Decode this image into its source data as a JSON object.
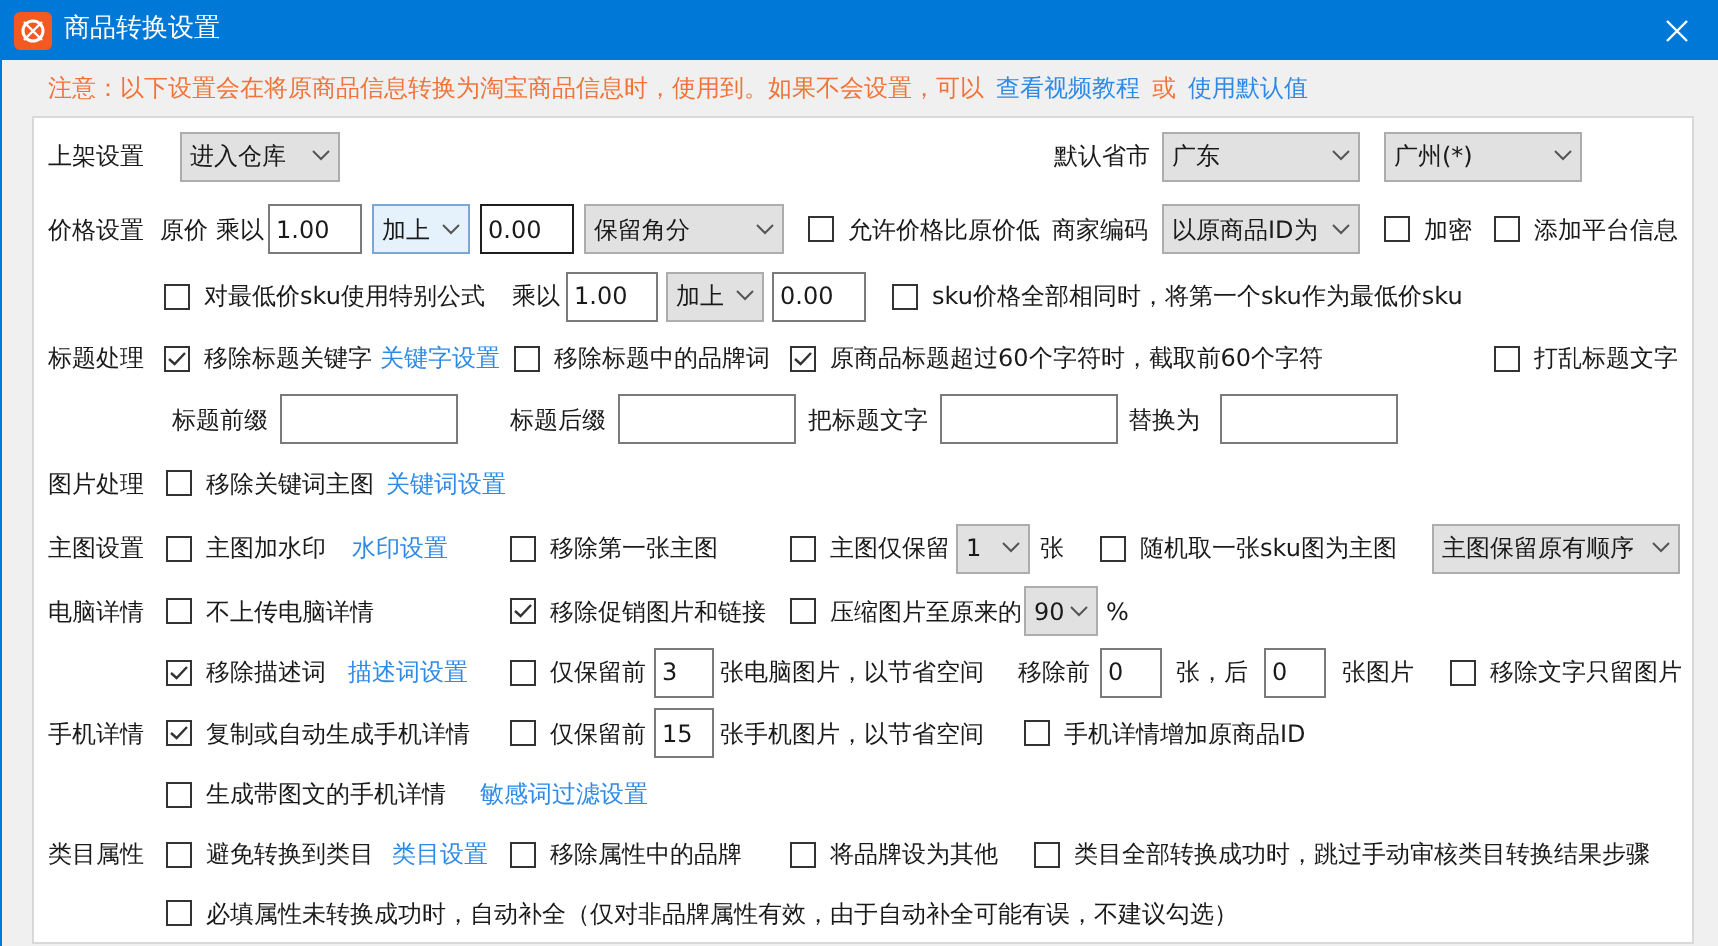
{
  "window": {
    "title": "商品转换设置"
  },
  "notice": [
    {
      "kind": "text",
      "text": "注意：以下设置会在将原商品信息转换为淘宝商品信息时，使用到。如果不会设置，可以"
    },
    {
      "kind": "link",
      "text": "查看视频教程"
    },
    {
      "kind": "text",
      "text": "或"
    },
    {
      "kind": "link",
      "text": "使用默认值"
    }
  ],
  "rows": [
    {
      "label": "上架设置",
      "items": [
        {
          "kind": "select",
          "value": "进入仓库"
        },
        {
          "kind": "text",
          "text": "默认省市"
        },
        {
          "kind": "select",
          "value": "广东"
        },
        {
          "kind": "select",
          "value": "广州(*)"
        }
      ]
    },
    {
      "label": "价格设置",
      "items": [
        {
          "kind": "text",
          "text": "原价"
        },
        {
          "kind": "text",
          "text": "乘以"
        },
        {
          "kind": "input",
          "value": "1.00",
          "focused": false
        },
        {
          "kind": "select",
          "value": "加上",
          "focused": true
        },
        {
          "kind": "input",
          "value": "0.00",
          "focused": true
        },
        {
          "kind": "select",
          "value": "保留角分"
        },
        {
          "kind": "checkbox",
          "text": "允许价格比原价低",
          "checked": false
        },
        {
          "kind": "text",
          "text": "商家编码"
        },
        {
          "kind": "select",
          "value": "以原商品ID为"
        },
        {
          "kind": "checkbox",
          "text": "加密",
          "checked": false
        },
        {
          "kind": "checkbox",
          "text": "添加平台信息",
          "checked": false
        }
      ]
    },
    {
      "items": [
        {
          "kind": "checkbox",
          "text": "对最低价sku使用特别公式",
          "checked": false
        },
        {
          "kind": "text",
          "text": "乘以"
        },
        {
          "kind": "input",
          "value": "1.00",
          "focused": false
        },
        {
          "kind": "select",
          "value": "加上"
        },
        {
          "kind": "input",
          "value": "0.00",
          "focused": false
        },
        {
          "kind": "checkbox",
          "text": "sku价格全部相同时，将第一个sku作为最低价sku",
          "checked": false
        }
      ]
    },
    {
      "label": "标题处理",
      "items": [
        {
          "kind": "checkbox",
          "text": "移除标题关键字",
          "checked": true
        },
        {
          "kind": "link",
          "text": "关键字设置"
        },
        {
          "kind": "checkbox",
          "text": "移除标题中的品牌词",
          "checked": false
        },
        {
          "kind": "checkbox",
          "text": "原商品标题超过60个字符时，截取前60个字符",
          "checked": true
        },
        {
          "kind": "checkbox",
          "text": "打乱标题文字",
          "checked": false
        }
      ]
    },
    {
      "items": [
        {
          "kind": "text",
          "text": "标题前缀"
        },
        {
          "kind": "input",
          "value": "",
          "focused": false
        },
        {
          "kind": "text",
          "text": "标题后缀"
        },
        {
          "kind": "input",
          "value": "",
          "focused": false
        },
        {
          "kind": "text",
          "text": "把标题文字"
        },
        {
          "kind": "input",
          "value": "",
          "focused": false
        },
        {
          "kind": "text",
          "text": "替换为"
        },
        {
          "kind": "input",
          "value": "",
          "focused": false
        }
      ]
    },
    {
      "label": "图片处理",
      "items": [
        {
          "kind": "checkbox",
          "text": "移除关键词主图",
          "checked": false
        },
        {
          "kind": "link",
          "text": "关键词设置"
        }
      ]
    },
    {
      "label": "主图设置",
      "items": [
        {
          "kind": "checkbox",
          "text": "主图加水印",
          "checked": false
        },
        {
          "kind": "link",
          "text": "水印设置"
        },
        {
          "kind": "checkbox",
          "text": "移除第一张主图",
          "checked": false
        },
        {
          "kind": "checkbox",
          "text": "主图仅保留",
          "checked": false
        },
        {
          "kind": "select",
          "value": "1"
        },
        {
          "kind": "text",
          "text": "张"
        },
        {
          "kind": "checkbox",
          "text": "随机取一张sku图为主图",
          "checked": false
        },
        {
          "kind": "select",
          "value": "主图保留原有顺序"
        }
      ]
    },
    {
      "label": "电脑详情",
      "items": [
        {
          "kind": "checkbox",
          "text": "不上传电脑详情",
          "checked": false
        },
        {
          "kind": "checkbox",
          "text": "移除促销图片和链接",
          "checked": true
        },
        {
          "kind": "checkbox",
          "text": "压缩图片至原来的",
          "checked": false
        },
        {
          "kind": "select",
          "value": "90"
        },
        {
          "kind": "text",
          "text": "%"
        }
      ]
    },
    {
      "items": [
        {
          "kind": "checkbox",
          "text": "移除描述词",
          "checked": true
        },
        {
          "kind": "link",
          "text": "描述词设置"
        },
        {
          "kind": "checkbox",
          "text": "仅保留前",
          "checked": false
        },
        {
          "kind": "input",
          "value": "3",
          "focused": false
        },
        {
          "kind": "text",
          "text": "张电脑图片，以节省空间"
        },
        {
          "kind": "text",
          "text": "移除前"
        },
        {
          "kind": "input",
          "value": "0",
          "focused": false
        },
        {
          "kind": "text",
          "text": "张，后"
        },
        {
          "kind": "input",
          "value": "0",
          "focused": false
        },
        {
          "kind": "text",
          "text": "张图片"
        },
        {
          "kind": "checkbox",
          "text": "移除文字只留图片",
          "checked": false
        }
      ]
    },
    {
      "label": "手机详情",
      "items": [
        {
          "kind": "checkbox",
          "text": "复制或自动生成手机详情",
          "checked": true
        },
        {
          "kind": "checkbox",
          "text": "仅保留前",
          "checked": false
        },
        {
          "kind": "input",
          "value": "15",
          "focused": false
        },
        {
          "kind": "text",
          "text": "张手机图片，以节省空间"
        },
        {
          "kind": "checkbox",
          "text": "手机详情增加原商品ID",
          "checked": false
        }
      ]
    },
    {
      "items": [
        {
          "kind": "checkbox",
          "text": "生成带图文的手机详情",
          "checked": false
        },
        {
          "kind": "link",
          "text": "敏感词过滤设置"
        }
      ]
    },
    {
      "label": "类目属性",
      "items": [
        {
          "kind": "checkbox",
          "text": "避免转换到类目",
          "checked": false
        },
        {
          "kind": "link",
          "text": "类目设置"
        },
        {
          "kind": "checkbox",
          "text": "移除属性中的品牌",
          "checked": false
        },
        {
          "kind": "checkbox",
          "text": "将品牌设为其他",
          "checked": false
        },
        {
          "kind": "checkbox",
          "text": "类目全部转换成功时，跳过手动审核类目转换结果步骤",
          "checked": false
        }
      ]
    },
    {
      "items": [
        {
          "kind": "checkbox",
          "text": "必填属性未转换成功时，自动补全（仅对非品牌属性有效，由于自动补全可能有误，不建议勾选）",
          "checked": false
        }
      ]
    }
  ]
}
